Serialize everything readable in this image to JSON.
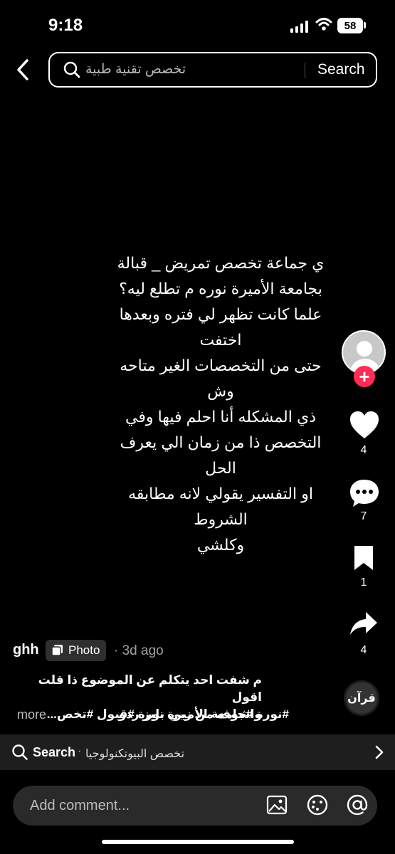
{
  "status_bar": {
    "time": "9:18",
    "battery": "58"
  },
  "search": {
    "query": "تخصص تقنية طبية",
    "button_label": "Search"
  },
  "post": {
    "text": "ي جماعة  تخصص تمريض _ قبالة\nبجامعة الأميرة نوره م تطلع ليه؟\nعلما كانت تظهر لي فتره وبعدها اختفت\nحتى من التخصصات الغير متاحه وش\nذي المشكله أنا احلم فيها وفي\nالتخصص ذا من زمان الي يعرف الحل\nاو التفسير يقولي لانه مطابقه الشروط\nوكلشي"
  },
  "actions": {
    "likes": "4",
    "comments": "7",
    "saves": "1",
    "shares": "4"
  },
  "author": {
    "username": "ghh",
    "badge": "Photo",
    "time": "· 3d ago"
  },
  "caption": {
    "text": "م شفت احد يتكلم عن الموضوع ذا قلت اقول\nواشوف من زيي بليز ردو",
    "tags": "#نورة #جامعة الأميرة نورة #قبول #تخص...",
    "more": "more"
  },
  "sound_label": "قرآن",
  "related": {
    "label": "Search",
    "separator": "·",
    "query": "تخصص البيوتكنولوجيا"
  },
  "comment": {
    "placeholder": "Add comment..."
  },
  "colors": {
    "accent": "#fe2c55",
    "background": "#000000",
    "bar": "#1e1e1e"
  }
}
